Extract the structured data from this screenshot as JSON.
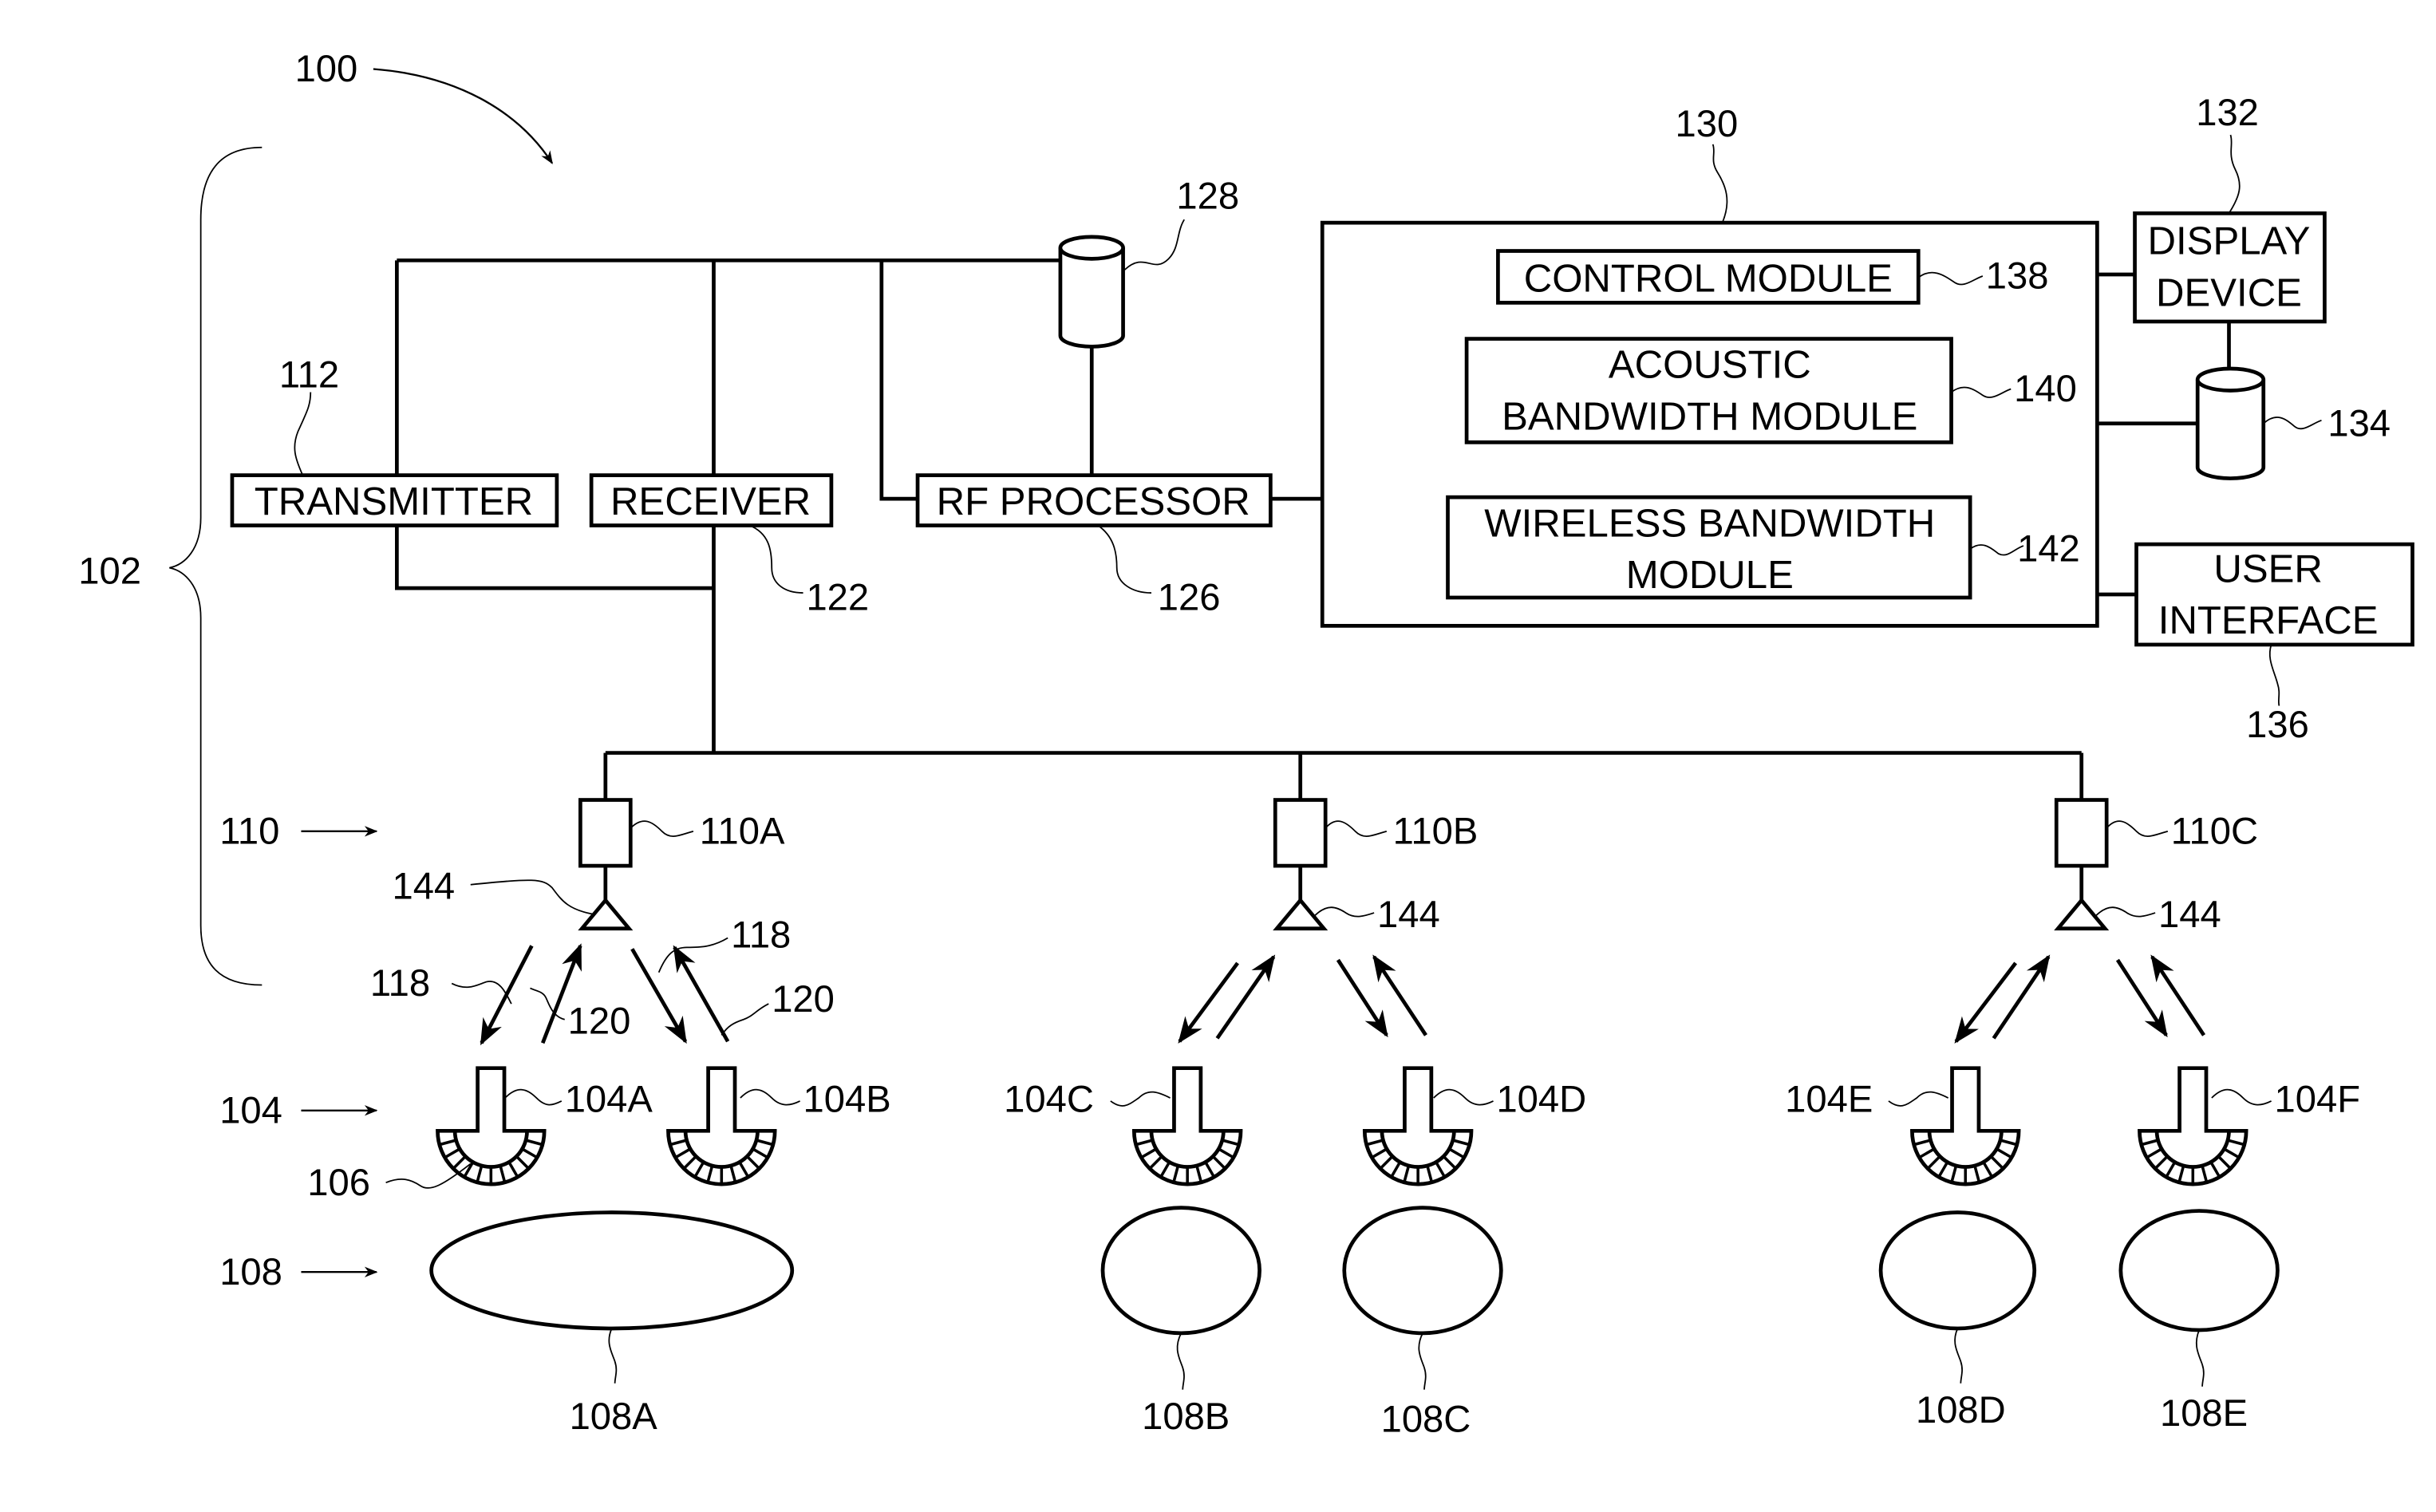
{
  "figure": {
    "ref_system": "100",
    "ref_front_end": "102",
    "blocks": {
      "transmitter": {
        "label": "TRANSMITTER",
        "ref": "112"
      },
      "receiver": {
        "label": "RECEIVER",
        "ref": "122"
      },
      "rf_processor": {
        "label": "RF PROCESSOR",
        "ref": "126"
      },
      "memory_128": {
        "ref": "128"
      },
      "processor_130": {
        "ref": "130"
      },
      "control_module": {
        "label": "CONTROL MODULE",
        "ref": "138"
      },
      "acoustic_module": {
        "line1": "ACOUSTIC",
        "line2": "BANDWIDTH MODULE",
        "ref": "140"
      },
      "wireless_module": {
        "line1": "WIRELESS BANDWIDTH",
        "line2": "MODULE",
        "ref": "142"
      },
      "display_device": {
        "line1": "DISPLAY",
        "line2": "DEVICE",
        "ref": "132"
      },
      "memory_134": {
        "ref": "134"
      },
      "user_interface": {
        "line1": "USER",
        "line2": "INTERFACE",
        "ref": "136"
      }
    },
    "group_labels": {
      "wireless_units": "110",
      "transducers": "104",
      "targets": "108"
    },
    "wireless_units": [
      {
        "ref": "110A",
        "antenna_ref": "144"
      },
      {
        "ref": "110B",
        "antenna_ref": "144"
      },
      {
        "ref": "110C",
        "antenna_ref": "144"
      }
    ],
    "signal_refs": {
      "transmit": "118",
      "receive": "120"
    },
    "element_ref": "106",
    "transducers": [
      "104A",
      "104B",
      "104C",
      "104D",
      "104E",
      "104F"
    ],
    "targets": [
      "108A",
      "108B",
      "108C",
      "108D",
      "108E"
    ]
  }
}
